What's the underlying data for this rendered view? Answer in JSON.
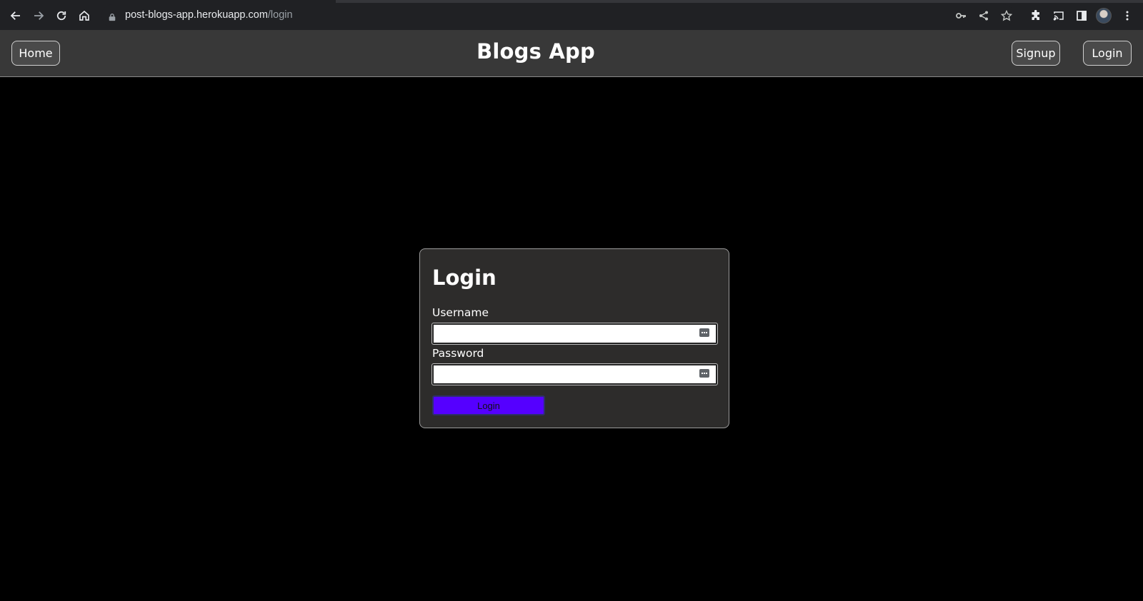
{
  "browser": {
    "url_host": "post-blogs-app.herokuapp.com",
    "url_path": "/login",
    "nav_icons": [
      "back-icon",
      "forward-icon",
      "reload-icon",
      "home-icon"
    ],
    "omnibox_icons": [
      "key-icon",
      "share-icon",
      "star-icon"
    ],
    "toolbar_icons": [
      "extensions-icon",
      "cast-icon",
      "side-panel-icon",
      "profile-avatar",
      "menu-icon"
    ]
  },
  "header": {
    "home_label": "Home",
    "title": "Blogs App",
    "signup_label": "Signup",
    "login_label": "Login"
  },
  "login_form": {
    "heading": "Login",
    "username_label": "Username",
    "username_value": "",
    "password_label": "Password",
    "password_value": "",
    "submit_label": "Login"
  },
  "colors": {
    "page_background": "#000000",
    "header_background": "#383838",
    "card_background": "#2d2c2b",
    "submit_button": "#5500ff"
  }
}
